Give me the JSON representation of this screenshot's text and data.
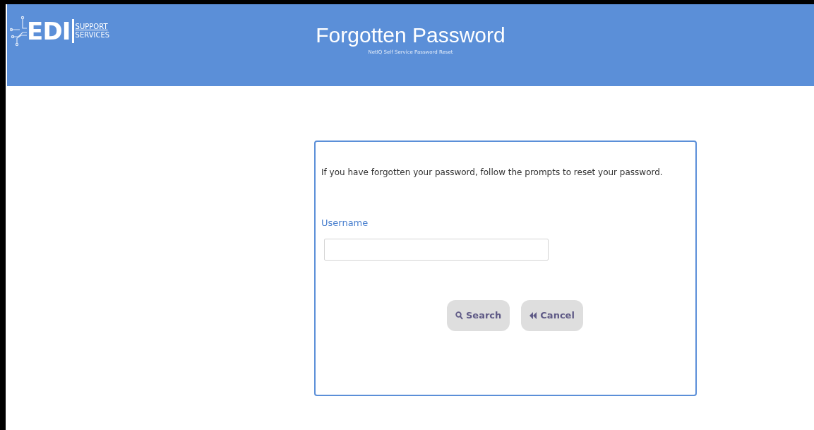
{
  "header": {
    "logo": {
      "mark": "EDI",
      "line_1": "SUPPORT",
      "line_2": "SERVICES"
    },
    "title": "Forgotten Password",
    "subtitle": "NetIQ Self Service Password Reset"
  },
  "form": {
    "intro": "If you have forgotten your password, follow the prompts to reset your password.",
    "field_label": "Username",
    "buttons": [
      {
        "kind": "search",
        "label": "Search"
      },
      {
        "kind": "cancel",
        "label": "Cancel"
      }
    ]
  }
}
